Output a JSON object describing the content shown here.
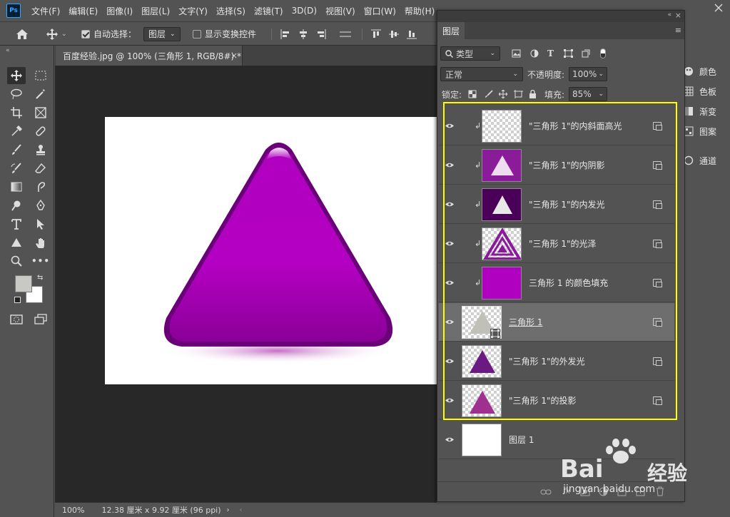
{
  "menubar": {
    "logo": "Ps",
    "items": [
      "文件(F)",
      "编辑(E)",
      "图像(I)",
      "图层(L)",
      "文字(Y)",
      "选择(S)",
      "滤镜(T)",
      "3D(D)",
      "视图(V)",
      "窗口(W)",
      "帮助(H)"
    ]
  },
  "options": {
    "auto_select_label": "自动选择：",
    "auto_select_value": "图层",
    "show_transform_label": "显示变换控件"
  },
  "document": {
    "tab_title": "百度经验.jpg @ 100% (三角形 1, RGB/8#) *",
    "zoom": "100%",
    "doc_info": "12.38 厘米 x 9.92 厘米 (96 ppi)",
    "shape_color": "#a000b0"
  },
  "right_dock": {
    "items": [
      "颜色",
      "色板",
      "渐变",
      "图案",
      "通道"
    ]
  },
  "layers_panel": {
    "tab_label": "图层",
    "filter_kind": "类型",
    "blend_mode": "正常",
    "opacity_label": "不透明度:",
    "opacity_value": "100%",
    "lock_label": "锁定:",
    "fill_label": "填充:",
    "fill_value": "85%",
    "layers": [
      {
        "name": "\"三角形  1\"的内斜面高光",
        "thumb": "checker"
      },
      {
        "name": "\"三角形  1\"的内阴影",
        "thumb": "inner-shadow"
      },
      {
        "name": "\"三角形  1\"的内发光",
        "thumb": "inner-glow"
      },
      {
        "name": "\"三角形  1\"的光泽",
        "thumb": "satin"
      },
      {
        "name": "三角形  1 的颜色填充",
        "thumb": "color-fill"
      },
      {
        "name": "三角形  1",
        "thumb": "shape"
      },
      {
        "name": "\"三角形  1\"的外发光",
        "thumb": "outer-glow"
      },
      {
        "name": "\"三角形  1\"的投影",
        "thumb": "drop-shadow"
      },
      {
        "name": "图层 1",
        "thumb": "white"
      }
    ],
    "highlight_color": "#ffff00"
  },
  "watermark": {
    "brand": "Bai",
    "brand_suffix": "经验",
    "url": "jingyan.baidu.com"
  }
}
